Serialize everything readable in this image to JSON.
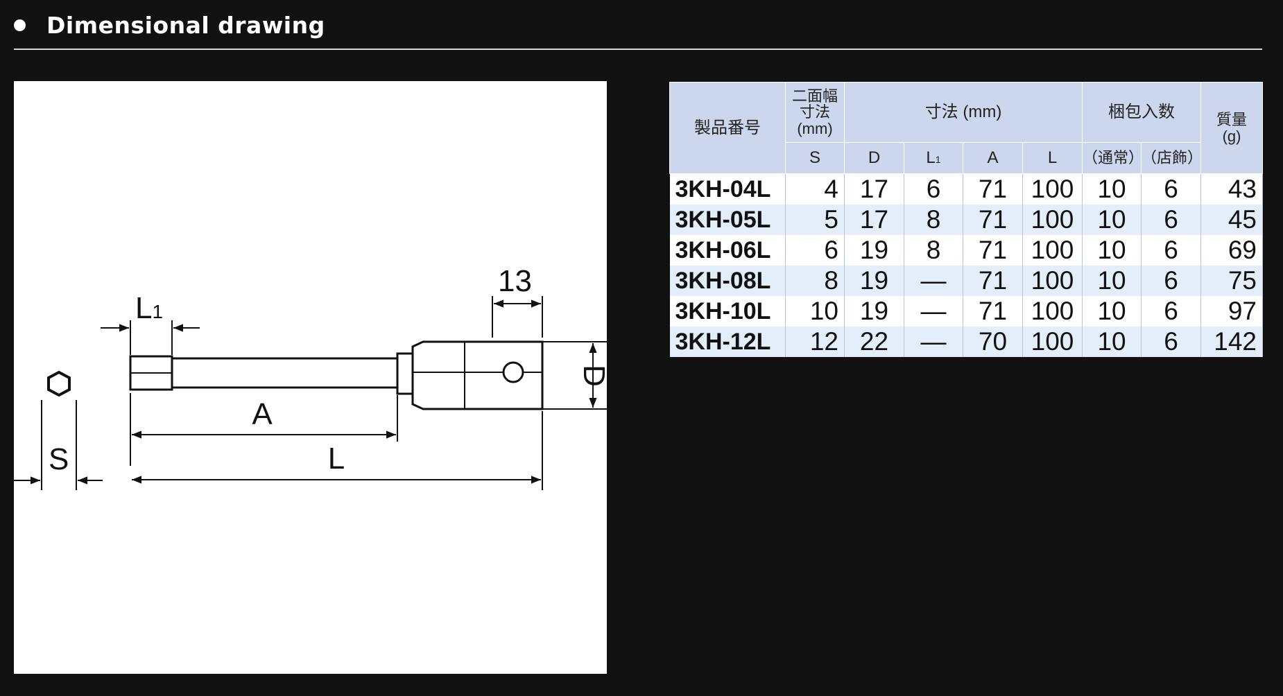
{
  "header": {
    "title": "Dimensional drawing"
  },
  "drawing": {
    "labels": {
      "L1": "L",
      "L1_sub": "1",
      "dim_13": "13",
      "D": "D",
      "A": "A",
      "L": "L",
      "S": "S"
    }
  },
  "table": {
    "headers": {
      "product_no": "製品番号",
      "width_across_flats": [
        "二面幅",
        "寸法",
        "(mm)"
      ],
      "dimensions": "寸法 (mm)",
      "packing_qty": "梱包入数",
      "mass": [
        "質量",
        "(g)"
      ],
      "S": "S",
      "D": "D",
      "L1": "L",
      "L1_sub": "1",
      "A": "A",
      "L": "L",
      "normal": "（通常）",
      "store": "（店飾）"
    },
    "rows": [
      {
        "pn": "3KH-04L",
        "S": "4",
        "D": "17",
        "L1": "6",
        "A": "71",
        "L": "100",
        "normal": "10",
        "store": "6",
        "mass": "43"
      },
      {
        "pn": "3KH-05L",
        "S": "5",
        "D": "17",
        "L1": "8",
        "A": "71",
        "L": "100",
        "normal": "10",
        "store": "6",
        "mass": "45"
      },
      {
        "pn": "3KH-06L",
        "S": "6",
        "D": "19",
        "L1": "8",
        "A": "71",
        "L": "100",
        "normal": "10",
        "store": "6",
        "mass": "69"
      },
      {
        "pn": "3KH-08L",
        "S": "8",
        "D": "19",
        "L1": "—",
        "A": "71",
        "L": "100",
        "normal": "10",
        "store": "6",
        "mass": "75"
      },
      {
        "pn": "3KH-10L",
        "S": "10",
        "D": "19",
        "L1": "—",
        "A": "71",
        "L": "100",
        "normal": "10",
        "store": "6",
        "mass": "97"
      },
      {
        "pn": "3KH-12L",
        "S": "12",
        "D": "22",
        "L1": "—",
        "A": "70",
        "L": "100",
        "normal": "10",
        "store": "6",
        "mass": "142"
      }
    ]
  }
}
